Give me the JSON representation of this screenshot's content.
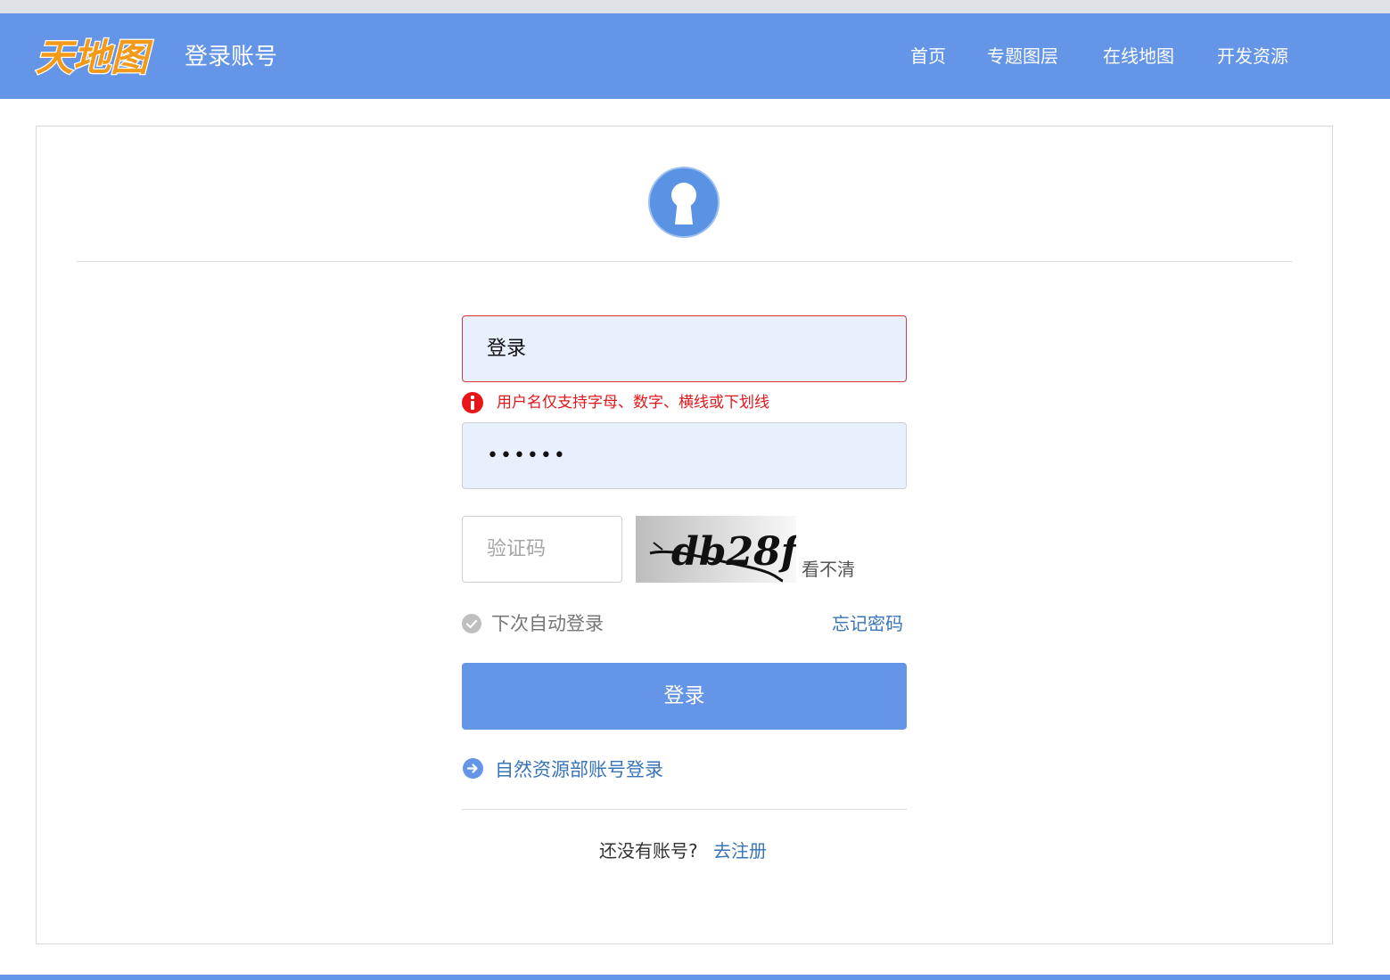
{
  "header": {
    "logo_text": "天地图",
    "title": "登录账号",
    "nav": [
      "首页",
      "专题图层",
      "在线地图",
      "开发资源"
    ]
  },
  "form": {
    "username_value": "登录",
    "username_error": "用户名仅支持字母、数字、横线或下划线",
    "password_value": "••••••",
    "captcha_placeholder": "验证码",
    "captcha_text": "db28f",
    "captcha_refresh": "看不清",
    "remember_label": "下次自动登录",
    "forgot_label": "忘记密码",
    "submit_label": "登录",
    "alt_login_label": "自然资源部账号登录",
    "register_prompt": "还没有账号?",
    "register_link": "去注册"
  },
  "colors": {
    "brand": "#6495e6",
    "error": "#e0171c",
    "link": "#3a74b8",
    "field_bg": "#e8f0fe"
  },
  "icons": [
    "lock-keyhole-icon",
    "error-icon",
    "check-circle-icon",
    "arrow-right-circle-icon"
  ]
}
